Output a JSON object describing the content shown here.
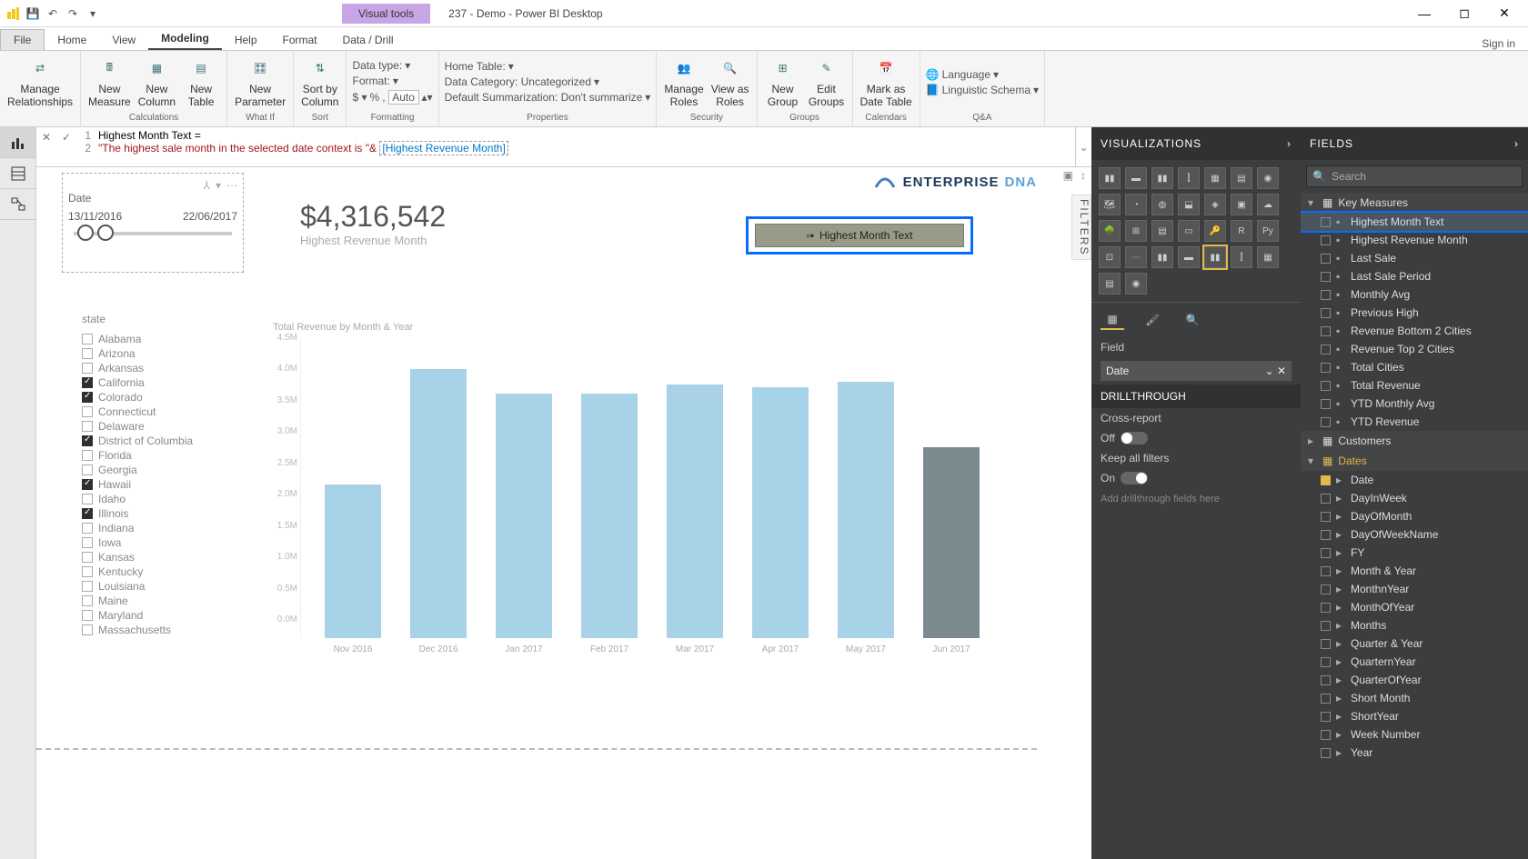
{
  "titlebar": {
    "contextual_tab": "Visual tools",
    "title": "237 - Demo - Power BI Desktop"
  },
  "tabs": {
    "file": "File",
    "home": "Home",
    "view": "View",
    "modeling": "Modeling",
    "help": "Help",
    "format": "Format",
    "data_drill": "Data / Drill",
    "signin": "Sign in"
  },
  "ribbon": {
    "manage_relationships": "Manage\nRelationships",
    "new_measure": "New\nMeasure",
    "new_column": "New\nColumn",
    "new_table": "New\nTable",
    "new_parameter": "New\nParameter",
    "sort_by_column": "Sort by\nColumn",
    "data_type": "Data type:",
    "format_lbl": "Format:",
    "auto": "Auto",
    "home_table": "Home Table:",
    "data_category": "Data Category: Uncategorized",
    "default_summarization": "Default Summarization: Don't summarize",
    "manage_roles": "Manage\nRoles",
    "view_as_roles": "View as\nRoles",
    "new_group": "New\nGroup",
    "edit_groups": "Edit\nGroups",
    "mark_as_date": "Mark as\nDate Table",
    "language": "Language",
    "linguistic_schema": "Linguistic Schema",
    "grp_calculations": "Calculations",
    "grp_whatif": "What If",
    "grp_sort": "Sort",
    "grp_formatting": "Formatting",
    "grp_properties": "Properties",
    "grp_security": "Security",
    "grp_groups": "Groups",
    "grp_calendars": "Calendars",
    "grp_qa": "Q&A"
  },
  "formula": {
    "line1": "Highest Month Text =",
    "line2_str": "\"The highest sale month in the selected date context is \"& ",
    "line2_measure": "[Highest Revenue Month]"
  },
  "canvas": {
    "filters_label": "FILTERS",
    "date_slicer": {
      "title": "Date",
      "start": "13/11/2016",
      "end": "22/06/2017"
    },
    "kpi": {
      "value": "$4,316,542",
      "label": "Highest Revenue Month"
    },
    "brand1": "ENTERPRISE",
    "brand2": "DNA",
    "card_placeholder": "Highest Month Text",
    "state_title": "state",
    "states": [
      {
        "name": "Alabama",
        "checked": false
      },
      {
        "name": "Arizona",
        "checked": false
      },
      {
        "name": "Arkansas",
        "checked": false
      },
      {
        "name": "California",
        "checked": true
      },
      {
        "name": "Colorado",
        "checked": true
      },
      {
        "name": "Connecticut",
        "checked": false
      },
      {
        "name": "Delaware",
        "checked": false
      },
      {
        "name": "District of Columbia",
        "checked": true
      },
      {
        "name": "Florida",
        "checked": false
      },
      {
        "name": "Georgia",
        "checked": false
      },
      {
        "name": "Hawaii",
        "checked": true
      },
      {
        "name": "Idaho",
        "checked": false
      },
      {
        "name": "Illinois",
        "checked": true
      },
      {
        "name": "Indiana",
        "checked": false
      },
      {
        "name": "Iowa",
        "checked": false
      },
      {
        "name": "Kansas",
        "checked": false
      },
      {
        "name": "Kentucky",
        "checked": false
      },
      {
        "name": "Louisiana",
        "checked": false
      },
      {
        "name": "Maine",
        "checked": false
      },
      {
        "name": "Maryland",
        "checked": false
      },
      {
        "name": "Massachusetts",
        "checked": false
      }
    ]
  },
  "chart_data": {
    "type": "bar",
    "title": "Total Revenue by Month & Year",
    "categories": [
      "Nov 2016",
      "Dec 2016",
      "Jan 2017",
      "Feb 2017",
      "Mar 2017",
      "Apr 2017",
      "May 2017",
      "Jun 2017"
    ],
    "values": [
      2450000,
      4300000,
      3900000,
      3900000,
      4050000,
      4000000,
      4100000,
      3050000
    ],
    "ylim": [
      0,
      4500000
    ],
    "yticks": [
      "0.0M",
      "0.5M",
      "1.0M",
      "1.5M",
      "2.0M",
      "2.5M",
      "3.0M",
      "3.5M",
      "4.0M",
      "4.5M"
    ],
    "highlight_index": 7
  },
  "vis_pane": {
    "title": "VISUALIZATIONS",
    "field_label": "Field",
    "field_value": "Date",
    "drillthrough": "DRILLTHROUGH",
    "cross_report": "Cross-report",
    "off": "Off",
    "keep_filters": "Keep all filters",
    "on": "On",
    "drill_placeholder": "Add drillthrough fields here"
  },
  "fields_pane": {
    "title": "FIELDS",
    "search": "Search",
    "tables": {
      "key_measures": "Key Measures",
      "customers": "Customers",
      "dates": "Dates"
    },
    "key_measures": [
      {
        "name": "Highest Month Text",
        "checked": false,
        "selected": true
      },
      {
        "name": "Highest Revenue Month",
        "checked": false
      },
      {
        "name": "Last Sale",
        "checked": false
      },
      {
        "name": "Last Sale Period",
        "checked": false
      },
      {
        "name": "Monthly Avg",
        "checked": false
      },
      {
        "name": "Previous High",
        "checked": false
      },
      {
        "name": "Revenue Bottom 2 Cities",
        "checked": false
      },
      {
        "name": "Revenue Top 2 Cities",
        "checked": false
      },
      {
        "name": "Total Cities",
        "checked": false
      },
      {
        "name": "Total Revenue",
        "checked": false
      },
      {
        "name": "YTD Monthly Avg",
        "checked": false
      },
      {
        "name": "YTD Revenue",
        "checked": false
      }
    ],
    "dates_fields": [
      {
        "name": "Date",
        "checked": true
      },
      {
        "name": "DayInWeek"
      },
      {
        "name": "DayOfMonth"
      },
      {
        "name": "DayOfWeekName"
      },
      {
        "name": "FY"
      },
      {
        "name": "Month & Year"
      },
      {
        "name": "MonthnYear"
      },
      {
        "name": "MonthOfYear"
      },
      {
        "name": "Months"
      },
      {
        "name": "Quarter & Year"
      },
      {
        "name": "QuarternYear"
      },
      {
        "name": "QuarterOfYear"
      },
      {
        "name": "Short Month"
      },
      {
        "name": "ShortYear"
      },
      {
        "name": "Week Number"
      },
      {
        "name": "Year"
      }
    ]
  }
}
